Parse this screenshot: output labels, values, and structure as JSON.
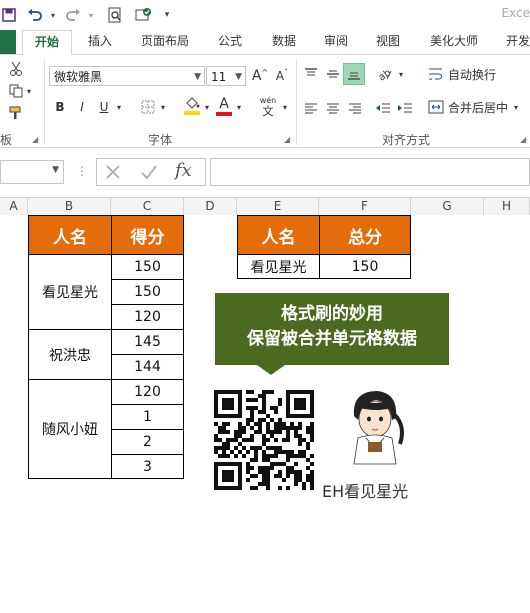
{
  "app": {
    "title": "Exce"
  },
  "tabs": [
    "开始",
    "插入",
    "页面布局",
    "公式",
    "数据",
    "审阅",
    "视图",
    "美化大师",
    "开发"
  ],
  "active_tab": "开始",
  "ribbon": {
    "font_name": "微软雅黑",
    "font_size": "11",
    "bold": "B",
    "italic": "I",
    "underline": "U",
    "increase_font": "A",
    "decrease_font": "A",
    "font_color_letter": "A",
    "phonetic": "wén",
    "phonetic_char": "文",
    "wrap_text": "自动换行",
    "merge_center": "合并后居中",
    "font_group": "字体",
    "align_group": "对齐方式",
    "clipboard_group": "板",
    "font_color_bar": "#e81123",
    "fill_color_bar": "#ffd800"
  },
  "formula_bar": {
    "name_box": "",
    "formula": "",
    "fx": "fx"
  },
  "columns": [
    "A",
    "B",
    "C",
    "D",
    "E",
    "F",
    "G",
    "H"
  ],
  "table1": {
    "headers": [
      "人名",
      "得分"
    ],
    "groups": [
      {
        "name": "看见星光",
        "scores": [
          "150",
          "150",
          "120"
        ]
      },
      {
        "name": "祝洪忠",
        "scores": [
          "145",
          "144"
        ]
      },
      {
        "name": "随风小妞",
        "scores": [
          "120",
          "1",
          "2",
          "3"
        ]
      }
    ]
  },
  "table2": {
    "headers": [
      "人名",
      "总分"
    ],
    "rows": [
      [
        "看见星光",
        "150"
      ]
    ]
  },
  "banner": {
    "line1": "格式刷的妙用",
    "line2": "保留被合并单元格数据"
  },
  "brand_text": "EH看见星光",
  "colors": {
    "header_orange": "#e46c0a",
    "banner_green": "#4a6b1f",
    "excel_green": "#217346"
  }
}
